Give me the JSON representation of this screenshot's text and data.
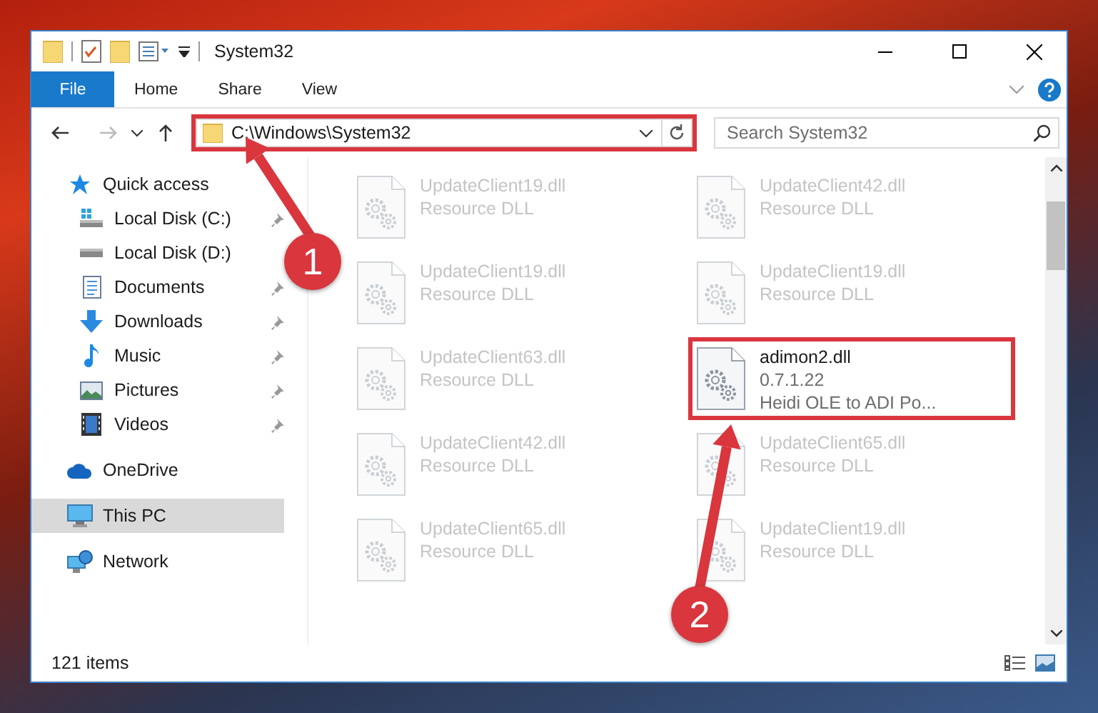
{
  "window": {
    "title": "System32"
  },
  "ribbon_tabs": [
    {
      "label": "File",
      "kind": "file"
    },
    {
      "label": "Home",
      "kind": "tab"
    },
    {
      "label": "Share",
      "kind": "tab"
    },
    {
      "label": "View",
      "kind": "tab"
    }
  ],
  "address_bar": {
    "value": "C:\\Windows\\System32",
    "highlighted": true
  },
  "search": {
    "placeholder": "Search System32"
  },
  "navigation": [
    {
      "label": "Quick access",
      "kind": "quick-access",
      "selected": false,
      "children": [
        {
          "label": "Local Disk (C:)",
          "kind": "system-drive",
          "pinned": true,
          "selected": false
        },
        {
          "label": "Local Disk (D:)",
          "kind": "drive",
          "pinned": false,
          "selected": false
        },
        {
          "label": "Documents",
          "kind": "documents",
          "pinned": true,
          "selected": false
        },
        {
          "label": "Downloads",
          "kind": "downloads",
          "pinned": true,
          "selected": false
        },
        {
          "label": "Music",
          "kind": "music",
          "pinned": true,
          "selected": false
        },
        {
          "label": "Pictures",
          "kind": "pictures",
          "pinned": true,
          "selected": false
        },
        {
          "label": "Videos",
          "kind": "videos",
          "pinned": true,
          "selected": false
        }
      ]
    },
    {
      "label": "OneDrive",
      "kind": "onedrive",
      "selected": false
    },
    {
      "label": "This PC",
      "kind": "pc",
      "selected": true
    },
    {
      "label": "Network",
      "kind": "network",
      "selected": false
    }
  ],
  "files": [
    {
      "name": "UpdateClient19.dll",
      "details": [
        "Resource DLL"
      ],
      "highlighted": false
    },
    {
      "name": "UpdateClient42.dll",
      "details": [
        "Resource DLL"
      ],
      "highlighted": false
    },
    {
      "name": "UpdateClient19.dll",
      "details": [
        "Resource DLL"
      ],
      "highlighted": false
    },
    {
      "name": "UpdateClient19.dll",
      "details": [
        "Resource DLL"
      ],
      "highlighted": false
    },
    {
      "name": "UpdateClient63.dll",
      "details": [
        "Resource DLL"
      ],
      "highlighted": false
    },
    {
      "name": "adimon2.dll",
      "details": [
        "0.7.1.22",
        "Heidi OLE to ADI Po..."
      ],
      "highlighted": true
    },
    {
      "name": "UpdateClient42.dll",
      "details": [
        "Resource DLL"
      ],
      "highlighted": false
    },
    {
      "name": "UpdateClient65.dll",
      "details": [
        "Resource DLL"
      ],
      "highlighted": false
    },
    {
      "name": "UpdateClient65.dll",
      "details": [
        "Resource DLL"
      ],
      "highlighted": false
    },
    {
      "name": "UpdateClient19.dll",
      "details": [
        "Resource DLL"
      ],
      "highlighted": false
    }
  ],
  "status_bar": {
    "item_count": "121 items"
  },
  "callouts": [
    {
      "number": "1"
    },
    {
      "number": "2"
    }
  ]
}
